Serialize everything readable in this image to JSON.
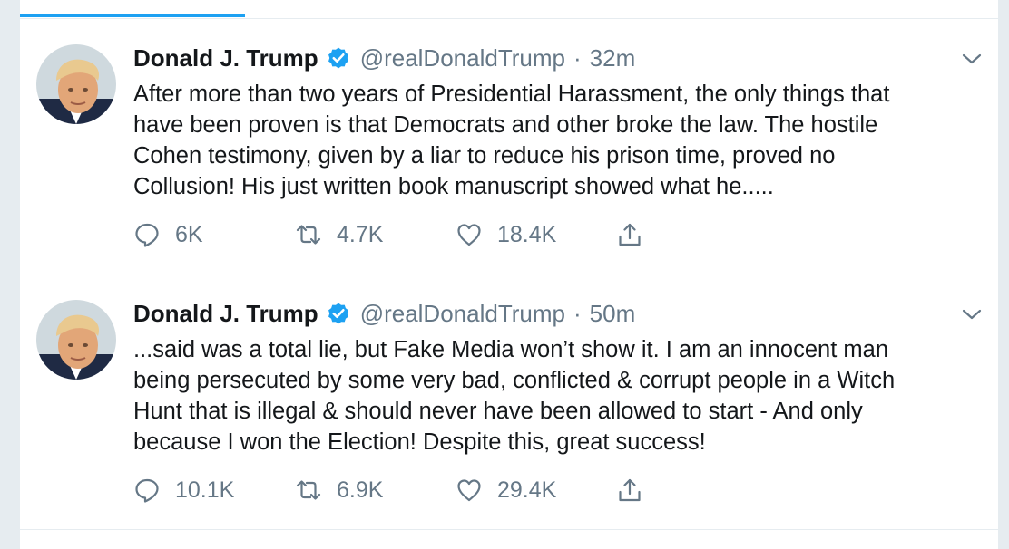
{
  "colors": {
    "accent": "#1da1f2",
    "secondary_text": "#657786",
    "primary_text": "#14171a",
    "divider": "#e6ecf0"
  },
  "tweets": [
    {
      "display_name": "Donald J. Trump",
      "handle": "@realDonaldTrump",
      "separator": "·",
      "time": "32m",
      "text_lines": [
        "After more than two years of Presidential Harassment, the only things that",
        "have been proven is that Democrats and other broke the law. The hostile",
        "Cohen testimony, given by a liar to reduce his prison time, proved no",
        "Collusion! His just written book manuscript showed what he....."
      ],
      "replies": "6K",
      "retweets": "4.7K",
      "likes": "18.4K",
      "icons": [
        "verified-badge-icon",
        "chevron-down-icon",
        "reply-icon",
        "retweet-icon",
        "heart-icon",
        "share-icon"
      ]
    },
    {
      "display_name": "Donald J. Trump",
      "handle": "@realDonaldTrump",
      "separator": "·",
      "time": "50m",
      "text_lines": [
        "...said was a total lie, but Fake Media won’t show it. I am an innocent man",
        "being persecuted by some very bad, conflicted & corrupt people in a Witch",
        "Hunt that is illegal & should never have been allowed to start - And only",
        "because I won the Election! Despite this, great success!"
      ],
      "replies": "10.1K",
      "retweets": "6.9K",
      "likes": "29.4K",
      "icons": [
        "verified-badge-icon",
        "chevron-down-icon",
        "reply-icon",
        "retweet-icon",
        "heart-icon",
        "share-icon"
      ]
    }
  ]
}
